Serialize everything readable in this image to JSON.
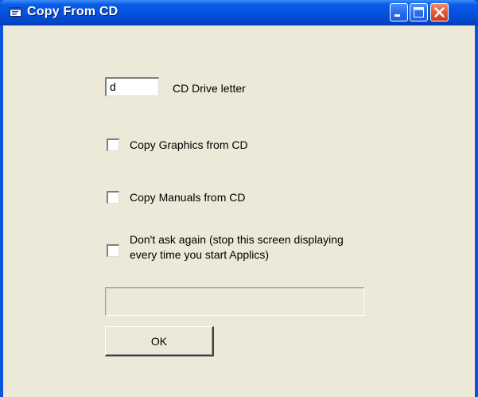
{
  "window": {
    "title": "Copy From CD",
    "icon": "cd-window-icon",
    "controls": {
      "minimize": "minimize-icon",
      "maximize": "maximize-icon",
      "close": "close-icon"
    }
  },
  "form": {
    "drive_letter_value": "d",
    "drive_letter_label": "CD Drive letter",
    "copy_graphics_label": "Copy Graphics from CD",
    "copy_graphics_checked": false,
    "copy_manuals_label": "Copy Manuals from CD",
    "copy_manuals_checked": false,
    "dont_ask_label_line1": "Don't ask again (stop this screen displaying",
    "dont_ask_label_line2": "every time you start Applics)",
    "dont_ask_checked": false,
    "progress": 0,
    "ok_label": "OK"
  },
  "colors": {
    "titlebar": "#0550dc",
    "client_background": "#ece9d8",
    "close_button": "#e45a38"
  }
}
